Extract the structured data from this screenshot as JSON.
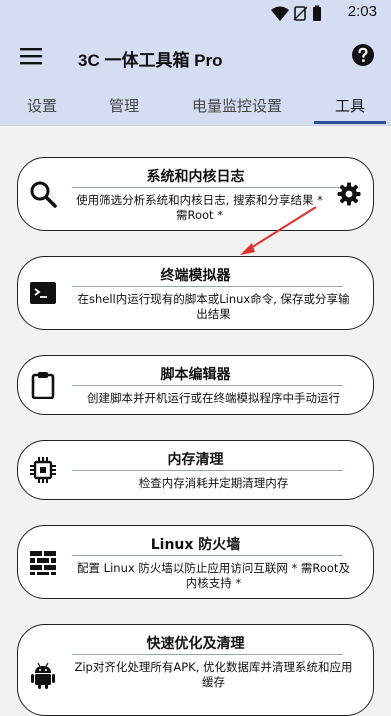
{
  "status": {
    "time": "2:03"
  },
  "app": {
    "title": "3C 一体工具箱 Pro"
  },
  "tabs": [
    {
      "label": "设置"
    },
    {
      "label": "管理"
    },
    {
      "label": "电量监控设置"
    },
    {
      "label": "工具"
    }
  ],
  "cards": [
    {
      "title": "系统和内核日志",
      "desc": "使用筛选分析系统和内核日志, 搜索和分享结果 * 需Root *",
      "icon": "search-icon"
    },
    {
      "title": "终端模拟器",
      "desc": "在shell内运行现有的脚本或Linux命令, 保存或分享输出结果",
      "icon": "terminal-icon"
    },
    {
      "title": "脚本编辑器",
      "desc": "创建脚本并开机运行或在终端模拟程序中手动运行",
      "icon": "clipboard-icon"
    },
    {
      "title": "内存清理",
      "desc": "检查内存消耗并定期清理内存",
      "icon": "chip-icon"
    },
    {
      "title": "Linux 防火墙",
      "desc": "配置 Linux 防火墙以防止应用访问互联网 * 需Root及内核支持 *",
      "icon": "brick-wall-icon"
    },
    {
      "title": "快速优化及清理",
      "desc": "Zip对齐化处理所有APK, 优化数据库并清理系统和应用缓存",
      "icon": "android-icon"
    }
  ],
  "colors": {
    "appbar": "#d4ddf1",
    "tab_indicator": "#2a4d9c",
    "arrow": "#e0322c"
  }
}
